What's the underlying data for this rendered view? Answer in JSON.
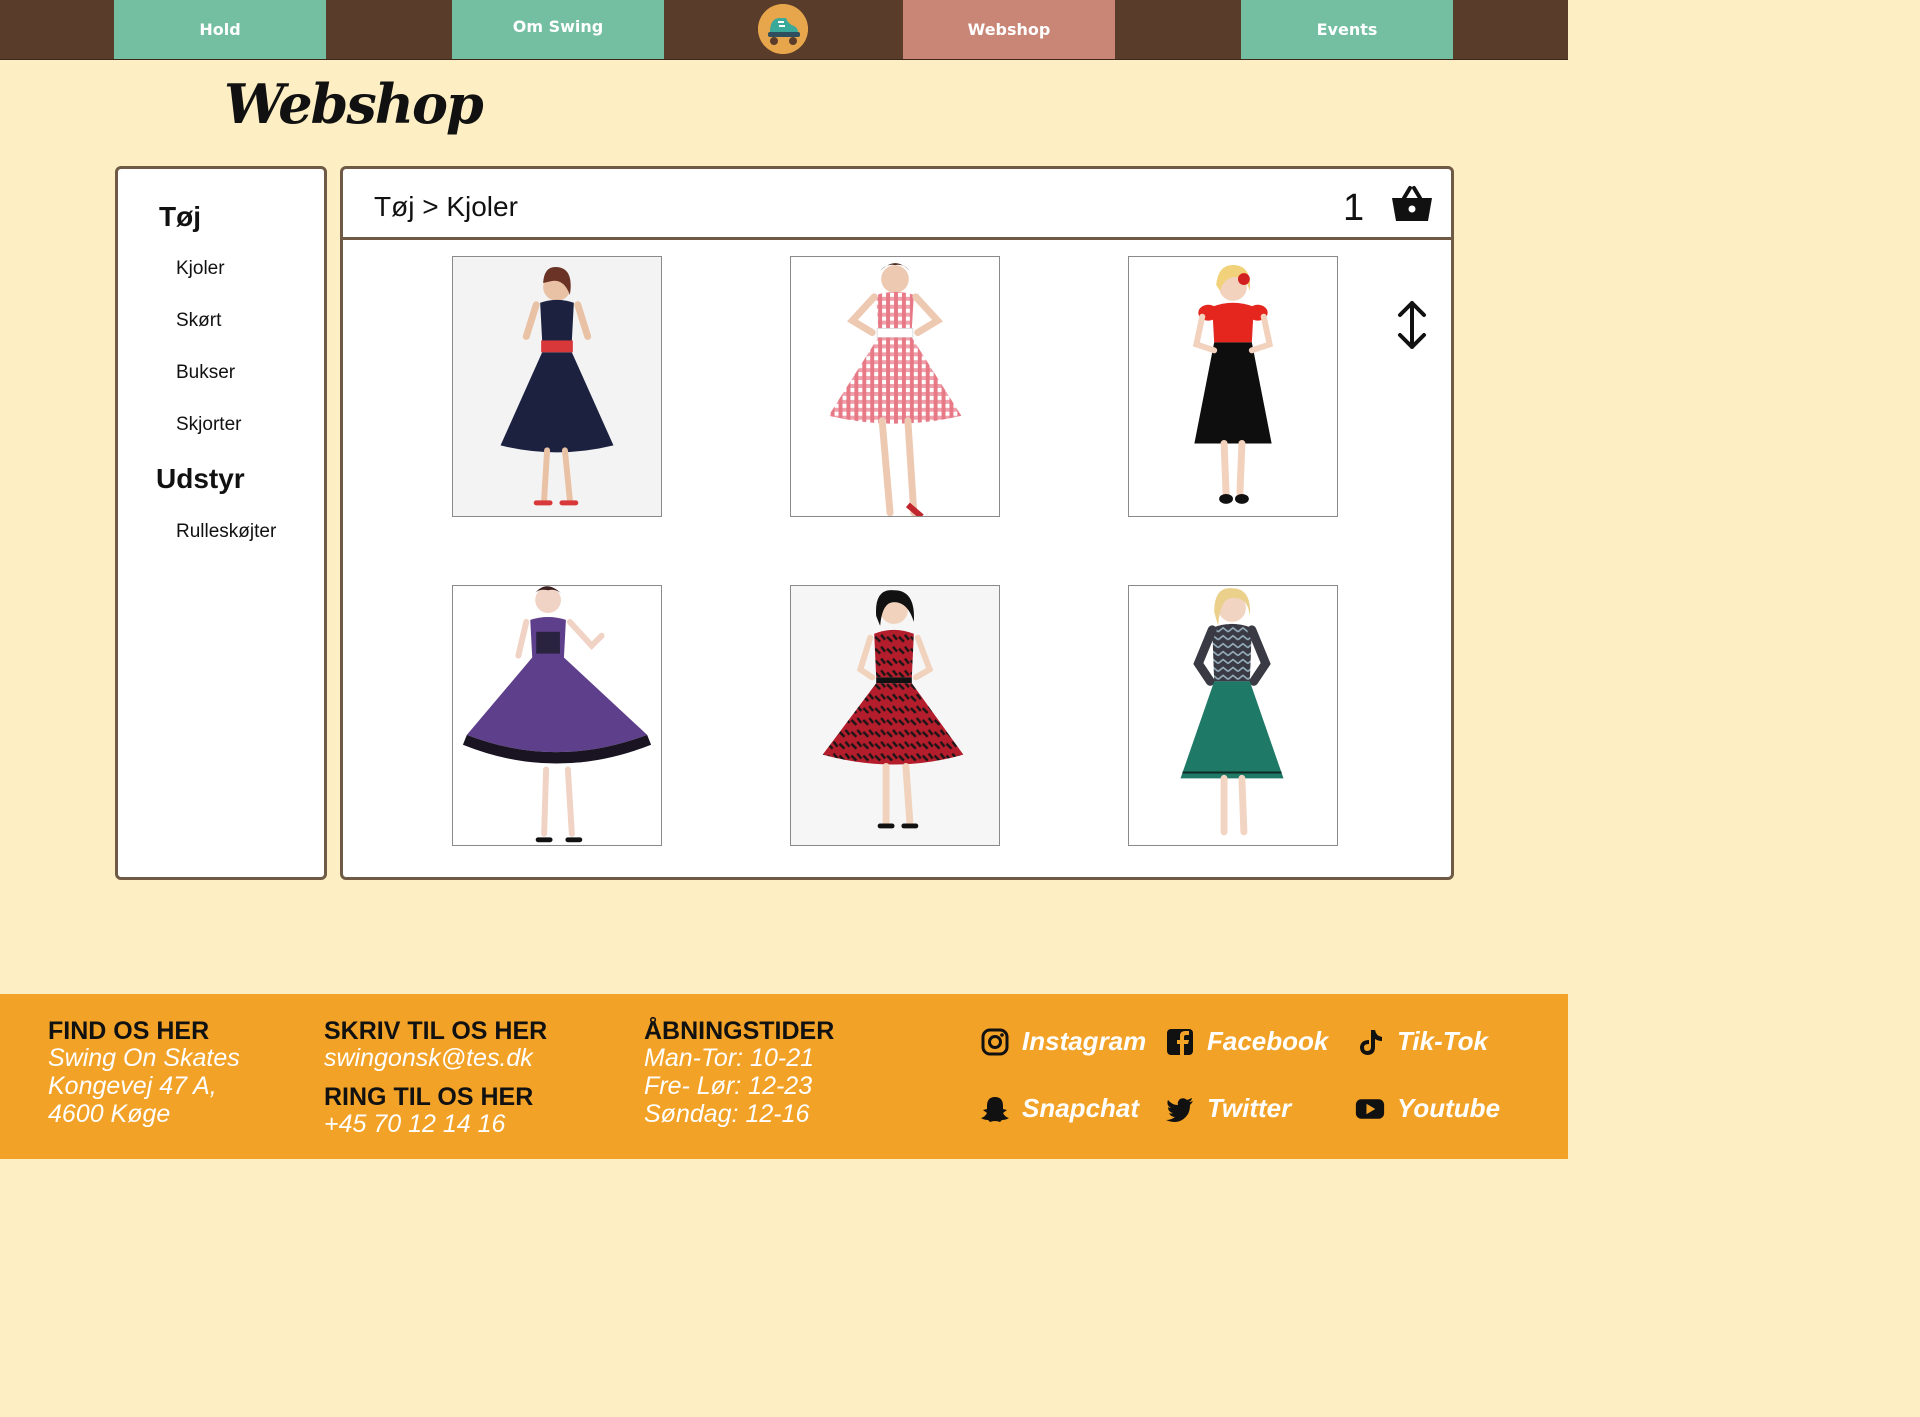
{
  "nav": {
    "hold": "Hold",
    "om_swing": "Om Swing",
    "webshop": "Webshop",
    "events": "Events",
    "logo_icon": "roller-skate-logo"
  },
  "page": {
    "title": "Webshop"
  },
  "sidebar": {
    "categories": [
      {
        "label": "Tøj",
        "items": [
          "Kjoler",
          "Skørt",
          "Bukser",
          "Skjorter"
        ]
      },
      {
        "label": "Udstyr",
        "items": [
          "Rulleskøjter"
        ]
      }
    ]
  },
  "main": {
    "breadcrumb": "Tøj > Kjoler",
    "cart_count": "1",
    "cart_icon": "basket-icon",
    "sort_icon": "up-down-arrow-icon",
    "products": [
      {
        "name": "navy-red-belt-dress",
        "colors": [
          "#1c2140",
          "#d8383a"
        ]
      },
      {
        "name": "red-gingham-dress",
        "colors": [
          "#e46a7a",
          "#ffffff"
        ]
      },
      {
        "name": "red-top-black-skirt-dress",
        "colors": [
          "#e5261e",
          "#0e0e0e"
        ]
      },
      {
        "name": "purple-polka-dress",
        "colors": [
          "#5e3f8c",
          "#1a1422"
        ]
      },
      {
        "name": "red-black-print-dress",
        "colors": [
          "#b41d2b",
          "#1c1517"
        ]
      },
      {
        "name": "green-skirt-patterned-top-dress",
        "colors": [
          "#1e7a66",
          "#3a3a44"
        ]
      }
    ]
  },
  "footer": {
    "find_heading": "FIND OS HER",
    "find_lines": [
      "Swing On Skates",
      "Kongevej 47 A,",
      "4600 Køge"
    ],
    "write_heading": "SKRIV TIL OS HER",
    "email": "swingonsk@tes.dk",
    "call_heading": "RING TIL OS HER",
    "phone": "+45 70 12 14 16",
    "hours_heading": "ÅBNINGSTIDER",
    "hours_lines": [
      "Man-Tor: 10-21",
      "Fre- Lør: 12-23",
      "Søndag: 12-16"
    ],
    "social": {
      "instagram": "Instagram",
      "facebook": "Facebook",
      "tiktok": "Tik-Tok",
      "snapchat": "Snapchat",
      "twitter": "Twitter",
      "youtube": "Youtube"
    }
  }
}
